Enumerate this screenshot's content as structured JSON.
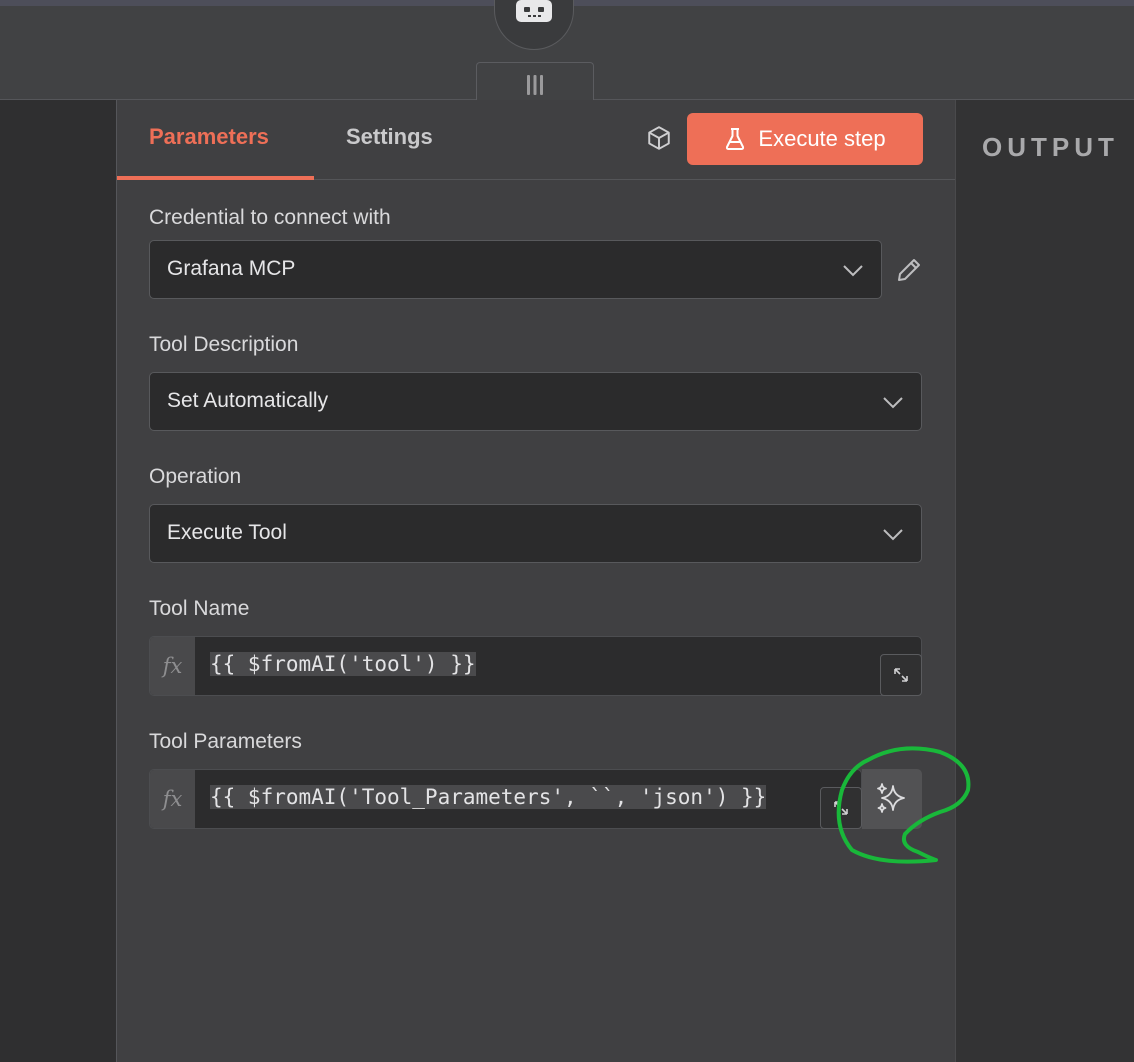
{
  "panel": {
    "tabs": {
      "parameters": "Parameters",
      "settings": "Settings"
    },
    "execute_button": "Execute step",
    "output_title": "OUTPUT"
  },
  "fields": {
    "credential": {
      "label": "Credential to connect with",
      "value": "Grafana MCP"
    },
    "tool_description": {
      "label": "Tool Description",
      "value": "Set Automatically"
    },
    "operation": {
      "label": "Operation",
      "value": "Execute Tool"
    },
    "tool_name": {
      "label": "Tool Name",
      "expression": "{{ $fromAI('tool') }}",
      "fx": "fx"
    },
    "tool_parameters": {
      "label": "Tool Parameters",
      "expression": "{{ $fromAI('Tool_Parameters', ``, 'json') }}",
      "fx": "fx"
    }
  },
  "icons": {
    "robot": "robot-icon",
    "handle": "drag-handle-icon",
    "cube": "cube-icon",
    "flask": "flask-icon",
    "chevron": "chevron-down-icon",
    "pencil": "pencil-icon",
    "expand": "expand-icon",
    "sparkles": "sparkles-icon"
  },
  "colors": {
    "accent": "#ee6f57",
    "annotation": "#19b83a"
  }
}
